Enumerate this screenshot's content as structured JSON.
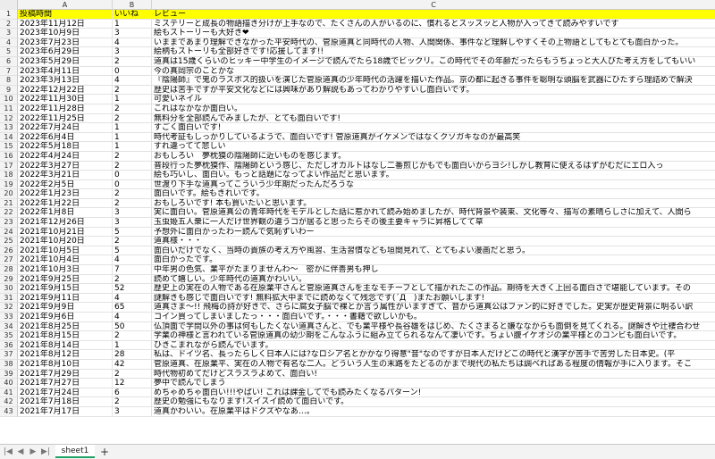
{
  "columns": {
    "row_header": "",
    "a": "A",
    "b": "B",
    "c": "C"
  },
  "header": {
    "row": "1",
    "a": "投稿時間",
    "b": "いいね",
    "c": "レビュー"
  },
  "rows": [
    {
      "n": "2",
      "a": "2023年11月12日",
      "b": "1",
      "c": "ミステリーと成長の物語描き分けが上手なので、たくさんの人がいるのに、慣れるとスッスッと人物が入ってきて読みやすいです"
    },
    {
      "n": "3",
      "a": "2023年10月9日",
      "b": "3",
      "c": "絵もストーリーも大好き❤"
    },
    {
      "n": "4",
      "a": "2023年7月23日",
      "b": "4",
      "c": "いままであまり理解できなかった平安時代の、菅原道真と同時代の人物、人間関係、事件など理解しやすくその上物語としてもとても面白かった。"
    },
    {
      "n": "5",
      "a": "2023年6月29日",
      "b": "3",
      "c": "絵柄もストーリも全部好きです!応援してます!!"
    },
    {
      "n": "6",
      "a": "2023年5月29日",
      "b": "2",
      "c": "道真は15歳くらいのヒッキー中学生のイメージで読んでたら18歳でビックリ。この時代でその年齢だったらもうちょっと大人びた考え方をしてもいい"
    },
    {
      "n": "7",
      "a": "2023年4月11日",
      "b": "0",
      "c": "今の真岡宗のことかな"
    },
    {
      "n": "8",
      "a": "2023年3月13日",
      "b": "4",
      "c": "『陰陽師』で鬼のラスボス的扱いを演じた菅原道真の少年時代の活躍を描いた作品。京の都に起きる事件を聡明な頭脳を武器にひたすら理詰めで解決"
    },
    {
      "n": "9",
      "a": "2022年12月22日",
      "b": "2",
      "c": "歴史は苦手ですが平安文化などには興味があり解説もあってわかりやすいし面白いです。"
    },
    {
      "n": "10",
      "a": "2022年11月30日",
      "b": "1",
      "c": "可愛いネイル"
    },
    {
      "n": "11",
      "a": "2022年11月28日",
      "b": "2",
      "c": "これはなかなか面白い。"
    },
    {
      "n": "12",
      "a": "2022年11月25日",
      "b": "2",
      "c": "無料分を全部読んでみましたが、とても面白いです!"
    },
    {
      "n": "13",
      "a": "2022年7月24日",
      "b": "1",
      "c": "すごく面白いです!"
    },
    {
      "n": "14",
      "a": "2022年6月4日",
      "b": "1",
      "c": "時代考証もしっかりしているようで、面白いです! 菅原道真がイケメンではなくクソガキなのが最高笑"
    },
    {
      "n": "15",
      "a": "2022年5月18日",
      "b": "1",
      "c": "すれ違ってて悲しい"
    },
    {
      "n": "16",
      "a": "2022年4月24日",
      "b": "2",
      "c": "おもしろい　夢枕獏の陰陽師に近いものを感じます。"
    },
    {
      "n": "17",
      "a": "2022年3月27日",
      "b": "2",
      "c": "普段行った夢枕獏作、陰陽師という感じ、ただしオカルトはなし二番煎じかもでも面白いからヨシ!しかし教育に使えるはずがむだにエロ入っ"
    },
    {
      "n": "18",
      "a": "2022年3月21日",
      "b": "0",
      "c": "絵も巧いし、面白い。もっと話題になってよい作品だと思います。"
    },
    {
      "n": "19",
      "a": "2022年2月5日",
      "b": "0",
      "c": "世渡り下手な道真ってこういう少年期だったんだろうな"
    },
    {
      "n": "20",
      "a": "2022年1月23日",
      "b": "2",
      "c": "面白いです。絵もきれいです。"
    },
    {
      "n": "21",
      "a": "2022年1月22日",
      "b": "2",
      "c": "おもしろいです! 本も買いたいと思います。"
    },
    {
      "n": "22",
      "a": "2022年1月8日",
      "b": "3",
      "c": "実に面白い。菅原道真公の青年時代をモデルとした話に惹かれて読み始めましたが、時代背景や装束、文化等々、描写の素晴らしさに加えて、人間ら"
    },
    {
      "n": "23",
      "a": "2021年12月26日",
      "b": "3",
      "c": "玉虫姫五人衆に一人だけ世界観の違うコが居ると思ったらその後主要キャラに昇格してて草"
    },
    {
      "n": "24",
      "a": "2021年10月21日",
      "b": "5",
      "c": "予想外に面白かったわー読んで気恥ずいわー"
    },
    {
      "n": "25",
      "a": "2021年10月20日",
      "b": "2",
      "c": "道真様・・・"
    },
    {
      "n": "26",
      "a": "2021年10月5日",
      "b": "5",
      "c": "面白いだけでなく、当時の貴族の考え方や風習、生活習慣なども垣間見れて、とてもよい漫画だと思う。"
    },
    {
      "n": "27",
      "a": "2021年10月4日",
      "b": "4",
      "c": "面白かったです。"
    },
    {
      "n": "28",
      "a": "2021年10月3日",
      "b": "7",
      "c": "中年男の色気、業平がたまりませんわ〜　密かに伴善男も押し"
    },
    {
      "n": "29",
      "a": "2021年9月25日",
      "b": "2",
      "c": "読めて嬉しい。少年時代の道真かわいい。"
    },
    {
      "n": "30",
      "a": "2021年9月15日",
      "b": "52",
      "c": "歴史上の実在の人物である在原業平さんと菅原道真さんを主なモチーフとして描かれたこの作品。期待を大きく上回る面白さで堪能しています。その"
    },
    {
      "n": "31",
      "a": "2021年9月11日",
      "b": "4",
      "c": "謎解きも感じで面白いです! 無料拡大中までに読めなくて残念です(´Д｀)またお願いします!"
    },
    {
      "n": "32",
      "a": "2021年9月9日",
      "b": "65",
      "c": "道真さま〜!! 飛梅の詩が好きで、さらに腐女子脳で裸とか言う属性がいますぎて、音から道真公はファン的に好きでした。史実が歴史背景に明るい訳"
    },
    {
      "n": "33",
      "a": "2021年9月6日",
      "b": "4",
      "c": "コイン買ってしまいましたっ・・・面白いです。・・・書籍で欲しいかも。"
    },
    {
      "n": "34",
      "a": "2021年8月25日",
      "b": "50",
      "c": "仏頂面で学問以外の事は何もしたくない道真さんと、でも業平様や長谷雄をはじめ、たくさまると嫌ななからも面倒を見てくれる。謎解きや辻褄合わせ"
    },
    {
      "n": "35",
      "a": "2021年8月15日",
      "b": "2",
      "c": "学業の神様と言われている菅原道真の幼少期をこんなふうに組み立てられるなんて凄いです。ちょい腹イケオジの業平様とのコンビも面白いです。"
    },
    {
      "n": "36",
      "a": "2021年8月14日",
      "b": "1",
      "c": "ひきこまれながら読んでいます。"
    },
    {
      "n": "37",
      "a": "2021年8月12日",
      "b": "28",
      "c": "私は、ドイツ名、長ったらしく日本人には?なロシア名とかかなり得意\"音\"なのですが日本人だけどこの時代と漢字が苦手で苦労した日本史。(平"
    },
    {
      "n": "38",
      "a": "2021年8月10日",
      "b": "42",
      "c": "菅原道真、在原業平、実在の人物で有名な二人。どういう人生の末路をたどるのかまで現代の私たちは調べればある程度の情報が手に入ります。そこ"
    },
    {
      "n": "39",
      "a": "2021年7月29日",
      "b": "2",
      "c": "時代物初めてだけどスラスラよめて、面白い!"
    },
    {
      "n": "40",
      "a": "2021年7月27日",
      "b": "12",
      "c": "夢中で読んでしまう"
    },
    {
      "n": "41",
      "a": "2021年7月24日",
      "b": "6",
      "c": "めちゃめちゃ面白い!!!やばい! これは課金してでも読みたくなるパターン!"
    },
    {
      "n": "42",
      "a": "2021年7月18日",
      "b": "2",
      "c": "歴史の勉強にもなります!スイスイ読めて面白いです。"
    },
    {
      "n": "43",
      "a": "2021年7月17日",
      "b": "3",
      "c": "道真かわいい。在原業平はドクズやなあ…。"
    }
  ],
  "tabs": {
    "nav_first": "|◀",
    "nav_prev": "◀",
    "nav_next": "▶",
    "nav_last": "▶|",
    "sheet_name": "sheet1",
    "add": "+"
  },
  "colors": {
    "header_fill": "#ffff00",
    "active_tab_accent": "#21a366"
  }
}
